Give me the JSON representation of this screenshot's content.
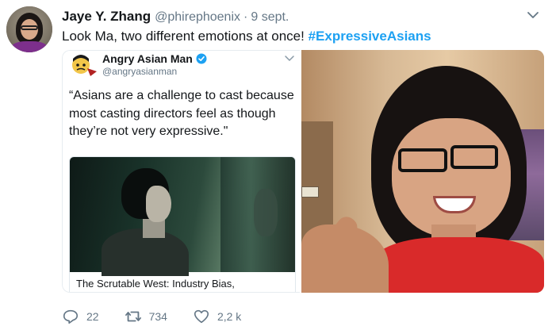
{
  "tweet": {
    "display_name": "Jaye Y. Zhang",
    "handle": "@phirephoenix",
    "separator": "·",
    "date": "9 sept.",
    "text": "Look Ma, two different emotions at once! ",
    "hashtag": "#ExpressiveAsians"
  },
  "quoted": {
    "display_name": "Angry Asian Man",
    "handle": "@angryasianman",
    "text": "“Asians are a challenge to cast because most casting directors feel as though they’re not very expressive.\"",
    "card_title": "The Scrutable West: Industry Bias, Whitewashing and the Invisible Asian in ..."
  },
  "actions": {
    "replies": "22",
    "retweets": "734",
    "likes": "2,2 k"
  },
  "icons": {
    "caret": "chevron-down-icon",
    "verified": "verified-badge-icon",
    "reply": "reply-icon",
    "retweet": "retweet-icon",
    "like": "heart-icon"
  },
  "colors": {
    "link": "#1da1f2",
    "muted": "#657786",
    "text": "#14171a",
    "verified": "#1da1f2"
  }
}
